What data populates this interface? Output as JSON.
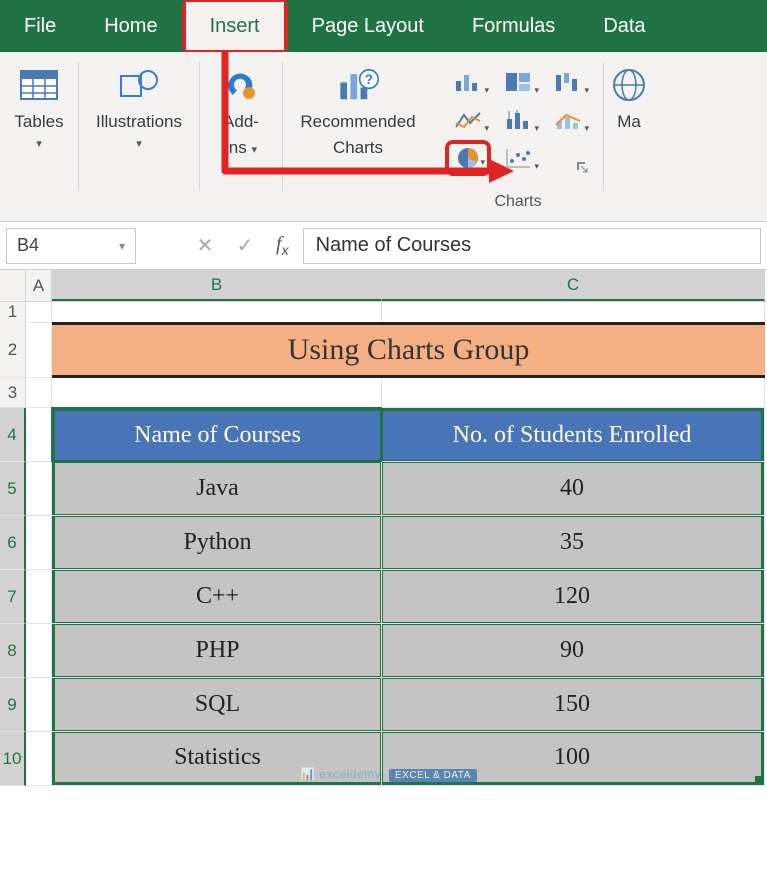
{
  "tabs": {
    "file": "File",
    "home": "Home",
    "insert": "Insert",
    "page_layout": "Page Layout",
    "formulas": "Formulas",
    "data": "Data"
  },
  "ribbon": {
    "tables": "Tables",
    "illustrations": "Illustrations",
    "addins_line1": "Add-",
    "addins_line2": "ins",
    "recommended_line1": "Recommended",
    "recommended_line2": "Charts",
    "charts_group": "Charts",
    "maps_partial": "Ma"
  },
  "namebox": "B4",
  "formula_value": "Name of Courses",
  "columns": {
    "a": "A",
    "b": "B",
    "c": "C"
  },
  "row_labels": [
    "1",
    "2",
    "3",
    "4",
    "5",
    "6",
    "7",
    "8",
    "9",
    "10"
  ],
  "title": "Using Charts Group",
  "table": {
    "headers": {
      "course": "Name of Courses",
      "enrolled": "No. of Students Enrolled"
    },
    "rows": [
      {
        "course": "Java",
        "enrolled": "40"
      },
      {
        "course": "Python",
        "enrolled": "35"
      },
      {
        "course": "C++",
        "enrolled": "120"
      },
      {
        "course": "PHP",
        "enrolled": "90"
      },
      {
        "course": "SQL",
        "enrolled": "150"
      },
      {
        "course": "Statistics",
        "enrolled": "100"
      }
    ]
  },
  "watermark": {
    "text": "exceldemy",
    "sub": "EXCEL & DATA"
  }
}
